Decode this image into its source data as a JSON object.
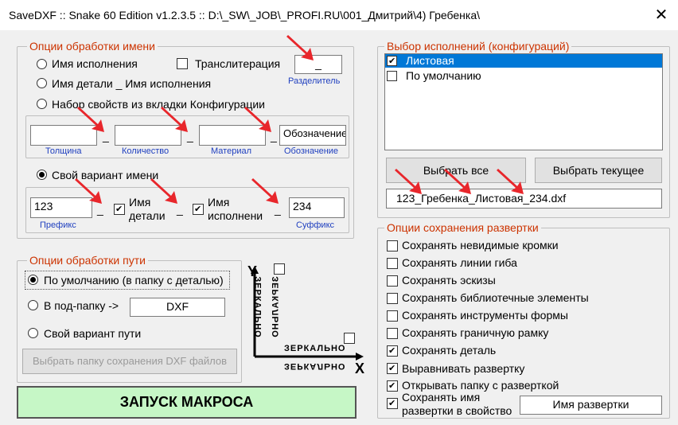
{
  "window": {
    "title": "SaveDXF :: Snake 60 Edition v1.2.3.5 ::    D:\\_SW\\_JOB\\_PROFI.RU\\001_Дмитрий\\4) Гребенка\\",
    "close_glyph": "✕"
  },
  "name_opts": {
    "legend": "Опции обработки имени",
    "radio_config": "Имя исполнения",
    "radio_part_config": "Имя детали _ Имя исполнения",
    "radio_props": "Набор свойств из вкладки Конфигурации",
    "translit": "Транслитерация",
    "separator_value": "_",
    "separator_caption": "Разделитель",
    "props_fields": [
      {
        "value": "",
        "caption": "Толщина"
      },
      {
        "value": "",
        "caption": "Количество"
      },
      {
        "value": "",
        "caption": "Материал"
      },
      {
        "value": "Обозначение",
        "caption": "Обозначение"
      }
    ],
    "radio_custom": "Свой вариант имени",
    "prefix_value": "123",
    "prefix_caption": "Префикс",
    "chk_part_label_1": "Имя",
    "chk_part_label_2": "детали",
    "chk_config_label_1": "Имя",
    "chk_config_label_2": "исполнени",
    "suffix_value": "234",
    "suffix_caption": "Суффикс",
    "dash": "_"
  },
  "path_opts": {
    "legend": "Опции обработки пути",
    "radio_default": "По умолчанию (в папку с деталью)",
    "radio_subfolder": "В под-папку ->",
    "subfolder_value": "DXF",
    "radio_custom": "Свой вариант пути",
    "choose_folder": "Выбрать папку сохранения DXF файлов"
  },
  "mirror": {
    "axis_y": "Y",
    "axis_x": "X",
    "label_v": "ЗЕРКАЛЬНО",
    "label_h": "ЗЕРКАЛЬНО"
  },
  "run_button": "ЗАПУСК МАКРОСА",
  "configs": {
    "legend": "Выбор исполнений (конфигураций)",
    "items": [
      {
        "label": "Листовая",
        "checked": true
      },
      {
        "label": "По умолчанию",
        "checked": false
      }
    ],
    "select_all": "Выбрать все",
    "select_current": "Выбрать текущее",
    "result_name": "123_Гребенка_Листовая_234.dxf"
  },
  "save_opts": {
    "legend": "Опции сохранения развертки",
    "items": [
      {
        "label": "Сохранять невидимые кромки",
        "checked": false
      },
      {
        "label": "Сохранять линии гиба",
        "checked": false
      },
      {
        "label": "Сохранять эскизы",
        "checked": false
      },
      {
        "label": "Сохранять библиотечные элементы",
        "checked": false
      },
      {
        "label": "Сохранять инструменты формы",
        "checked": false
      },
      {
        "label": "Сохранять граничную рамку",
        "checked": false
      },
      {
        "label": "Сохранять деталь",
        "checked": true
      },
      {
        "label": "Выравнивать развертку",
        "checked": true
      },
      {
        "label": "Открывать папку с разверткой",
        "checked": true
      }
    ],
    "save_name_1": "Сохранять имя",
    "save_name_2": "развертки в свойство",
    "property_value": "Имя развертки"
  },
  "colors": {
    "legend": "#cc3300",
    "caption": "#1f3fbf",
    "arrow": "#e8262b",
    "run_bg": "#c6f7c6",
    "selection": "#0078d7"
  }
}
